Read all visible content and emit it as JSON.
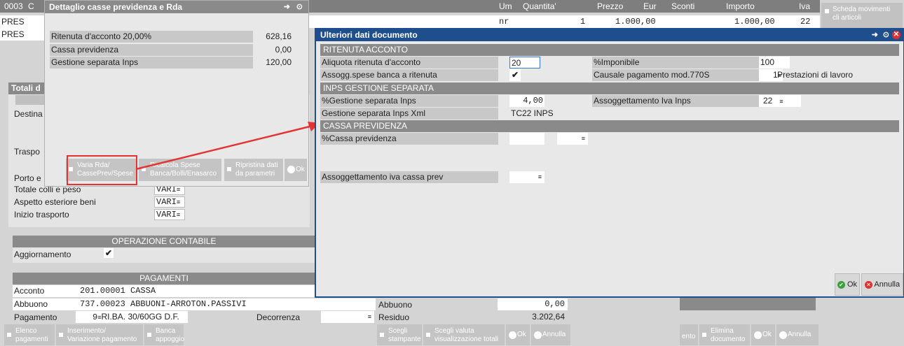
{
  "background": {
    "doc_code": "0003",
    "doc_code_suffix": "C",
    "rows": [
      {
        "code": "PRES",
        "um": "nr",
        "qty": "1",
        "price": "1.000,00",
        "importo": "1.000,00",
        "iva": "22"
      },
      {
        "code": "PRES"
      }
    ],
    "headers": {
      "um": "Um",
      "qty": "Quantita'",
      "price": "Prezzo",
      "eur": "Eur",
      "sconti": "Sconti",
      "importo": "Importo",
      "iva": "Iva"
    },
    "scheda_button": "Scheda movimenti cli articoli",
    "totali_label": "Totali d",
    "destina_label": "Destina",
    "traspo_label": "Traspo",
    "porto_label": "Porto e",
    "totale_colli": "Totale colli e peso",
    "aspetto": "Aspetto esteriore beni",
    "inizio": "Inizio trasporto",
    "vari": "VARI",
    "operazione_header": "OPERAZIONE CONTABILE",
    "aggiornamento": "Aggiornamento",
    "pagamenti_header": "PAGAMENTI",
    "acconto_label": "Acconto",
    "acconto_value": "201.00001 CASSA",
    "abbuono_label": "Abbuono",
    "abbuono_value": "737.00023 ABBUONI-ARROTON.PASSIVI",
    "abbuono_right_label": "Abbuono",
    "abbuono_right_value": "0,00",
    "pagamento_label": "Pagamento",
    "pagamento_value": "9",
    "pagamento_desc": "RI.BA. 30/60GG D.F.",
    "decorrenza_label": "Decorrenza",
    "residuo_label": "Residuo",
    "residuo_value": "3.202,64",
    "bottom_buttons": {
      "elenco": "Elenco pagamenti",
      "inserimento": "Inserimento/ Variazione pagamento",
      "banca": "Banca appoggio",
      "scegli_stampante": "Scegli stampante",
      "scegli_valuta": "Scegli valuta visualizzazione totali",
      "ok": "Ok",
      "annulla": "Annulla",
      "elimina": "Elimina documento",
      "ento": "ento"
    }
  },
  "dettaglio": {
    "title": "Dettaglio casse previdenza e Rda",
    "rows": [
      {
        "label": "Ritenuta d'acconto 20,00%",
        "value": "628,16"
      },
      {
        "label": "Cassa previdenza",
        "value": "0,00"
      },
      {
        "label": "Gestione separata Inps",
        "value": "120,00"
      }
    ],
    "buttons": {
      "varia": "Varia Rda/ CassePrev/Spese",
      "ricalcola": "Ricalcola Spese Banca/Bolli/Enasarco",
      "ripristina": "Ripristina dati da parametri",
      "ok": "Ok"
    }
  },
  "modal": {
    "title": "Ulteriori dati documento",
    "sections": {
      "ritenuta": "RITENUTA ACCONTO",
      "inps": "INPS GESTIONE SEPARATA",
      "cassa": "CASSA PREVIDENZA"
    },
    "aliquota_label": "Aliquota ritenuta d'acconto",
    "aliquota_value": "20",
    "imponibile_label": "%Imponibile",
    "imponibile_value": "100",
    "assogg_spese_label": "Assogg.spese banca a ritenuta",
    "causale_label": "Causale pagamento mod.770S",
    "causale_code": "1",
    "causale_desc": "Prestazioni di lavoro",
    "gestione_label": "%Gestione separata Inps",
    "gestione_value": "4,00",
    "assogg_iva_inps_label": "Assoggettamento Iva Inps",
    "assogg_iva_inps_value": "22",
    "gestione_xml_label": "Gestione separata Inps Xml",
    "gestione_xml_value": "TC22  INPS",
    "cassa_prev_label": "%Cassa previdenza",
    "assogg_iva_cassa_label": "Assoggettamento iva cassa prev",
    "ok": "Ok",
    "annulla": "Annulla"
  }
}
